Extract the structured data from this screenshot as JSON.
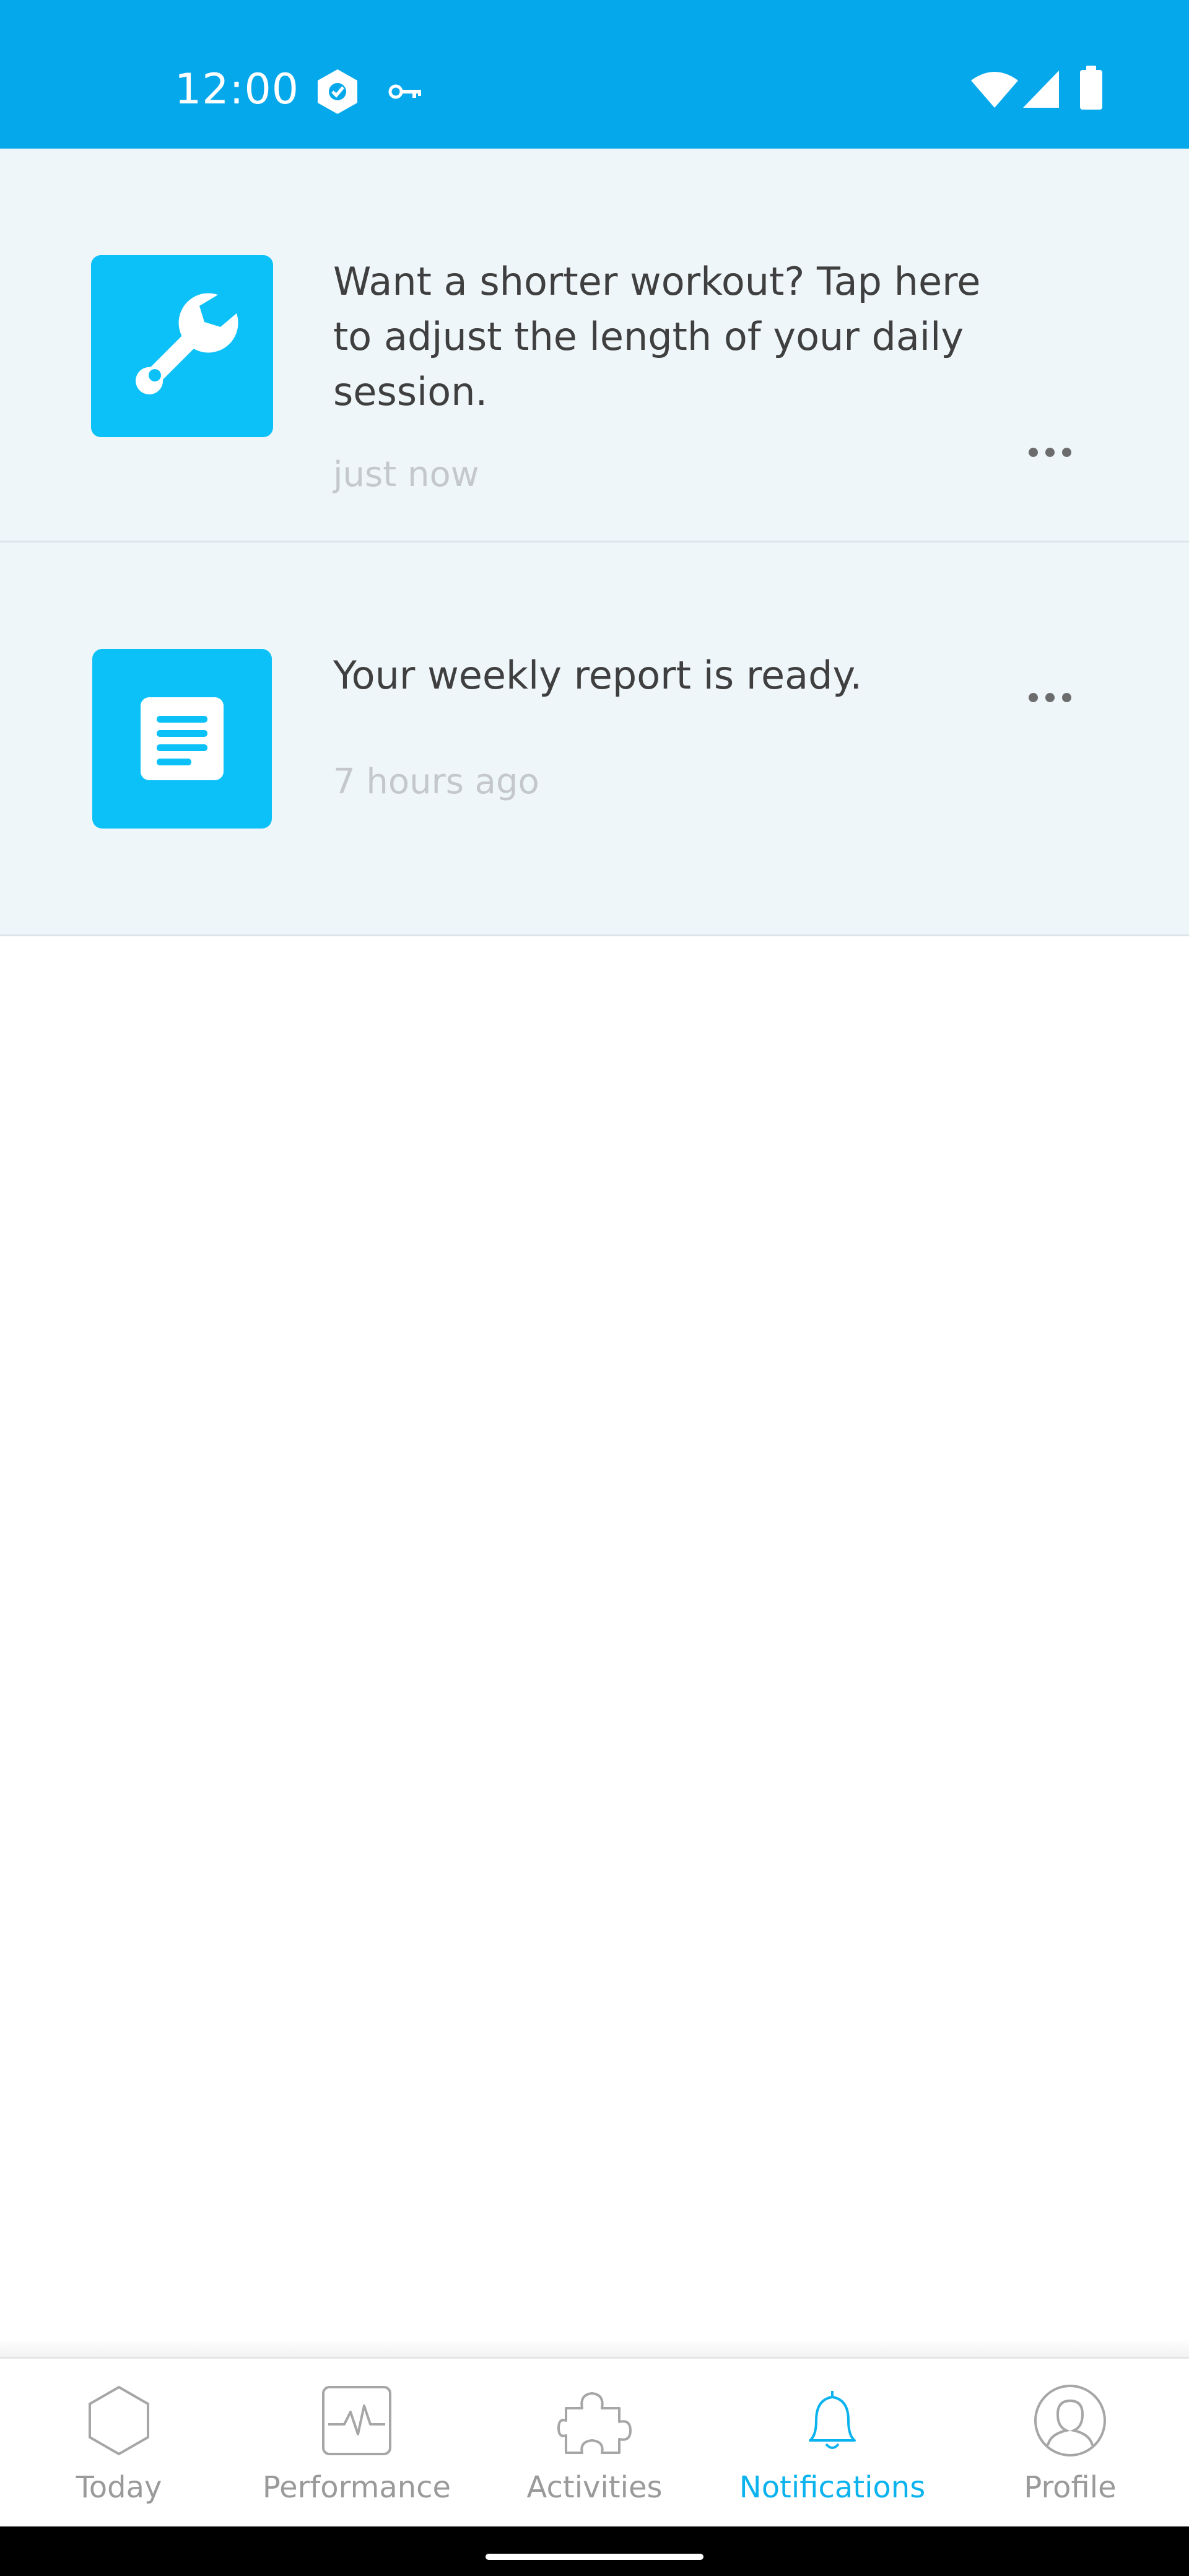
{
  "status_bar": {
    "time": "12:00",
    "icons": [
      "shield-app-icon",
      "vpn-key-icon",
      "wifi-icon",
      "cell-signal-icon",
      "battery-icon"
    ],
    "background": "#06a8ec"
  },
  "notifications": [
    {
      "icon": "wrench-icon",
      "text": "Want a shorter workout? Tap here to adjust the length of your daily session.",
      "time": "just now"
    },
    {
      "icon": "document-icon",
      "text": "Your weekly report is ready.",
      "time": "7 hours ago"
    }
  ],
  "bottom_nav": {
    "items": [
      {
        "label": "Today",
        "icon": "hexagon-icon",
        "active": false
      },
      {
        "label": "Performance",
        "icon": "pulse-chart-icon",
        "active": false
      },
      {
        "label": "Activities",
        "icon": "puzzle-icon",
        "active": false
      },
      {
        "label": "Notifications",
        "icon": "bell-icon",
        "active": true
      },
      {
        "label": "Profile",
        "icon": "profile-icon",
        "active": false
      }
    ],
    "active_color": "#0bb3ee",
    "inactive_color": "#9a9a9a"
  },
  "colors": {
    "accent": "#0bc1f8",
    "list_background": "#eef6fa"
  }
}
